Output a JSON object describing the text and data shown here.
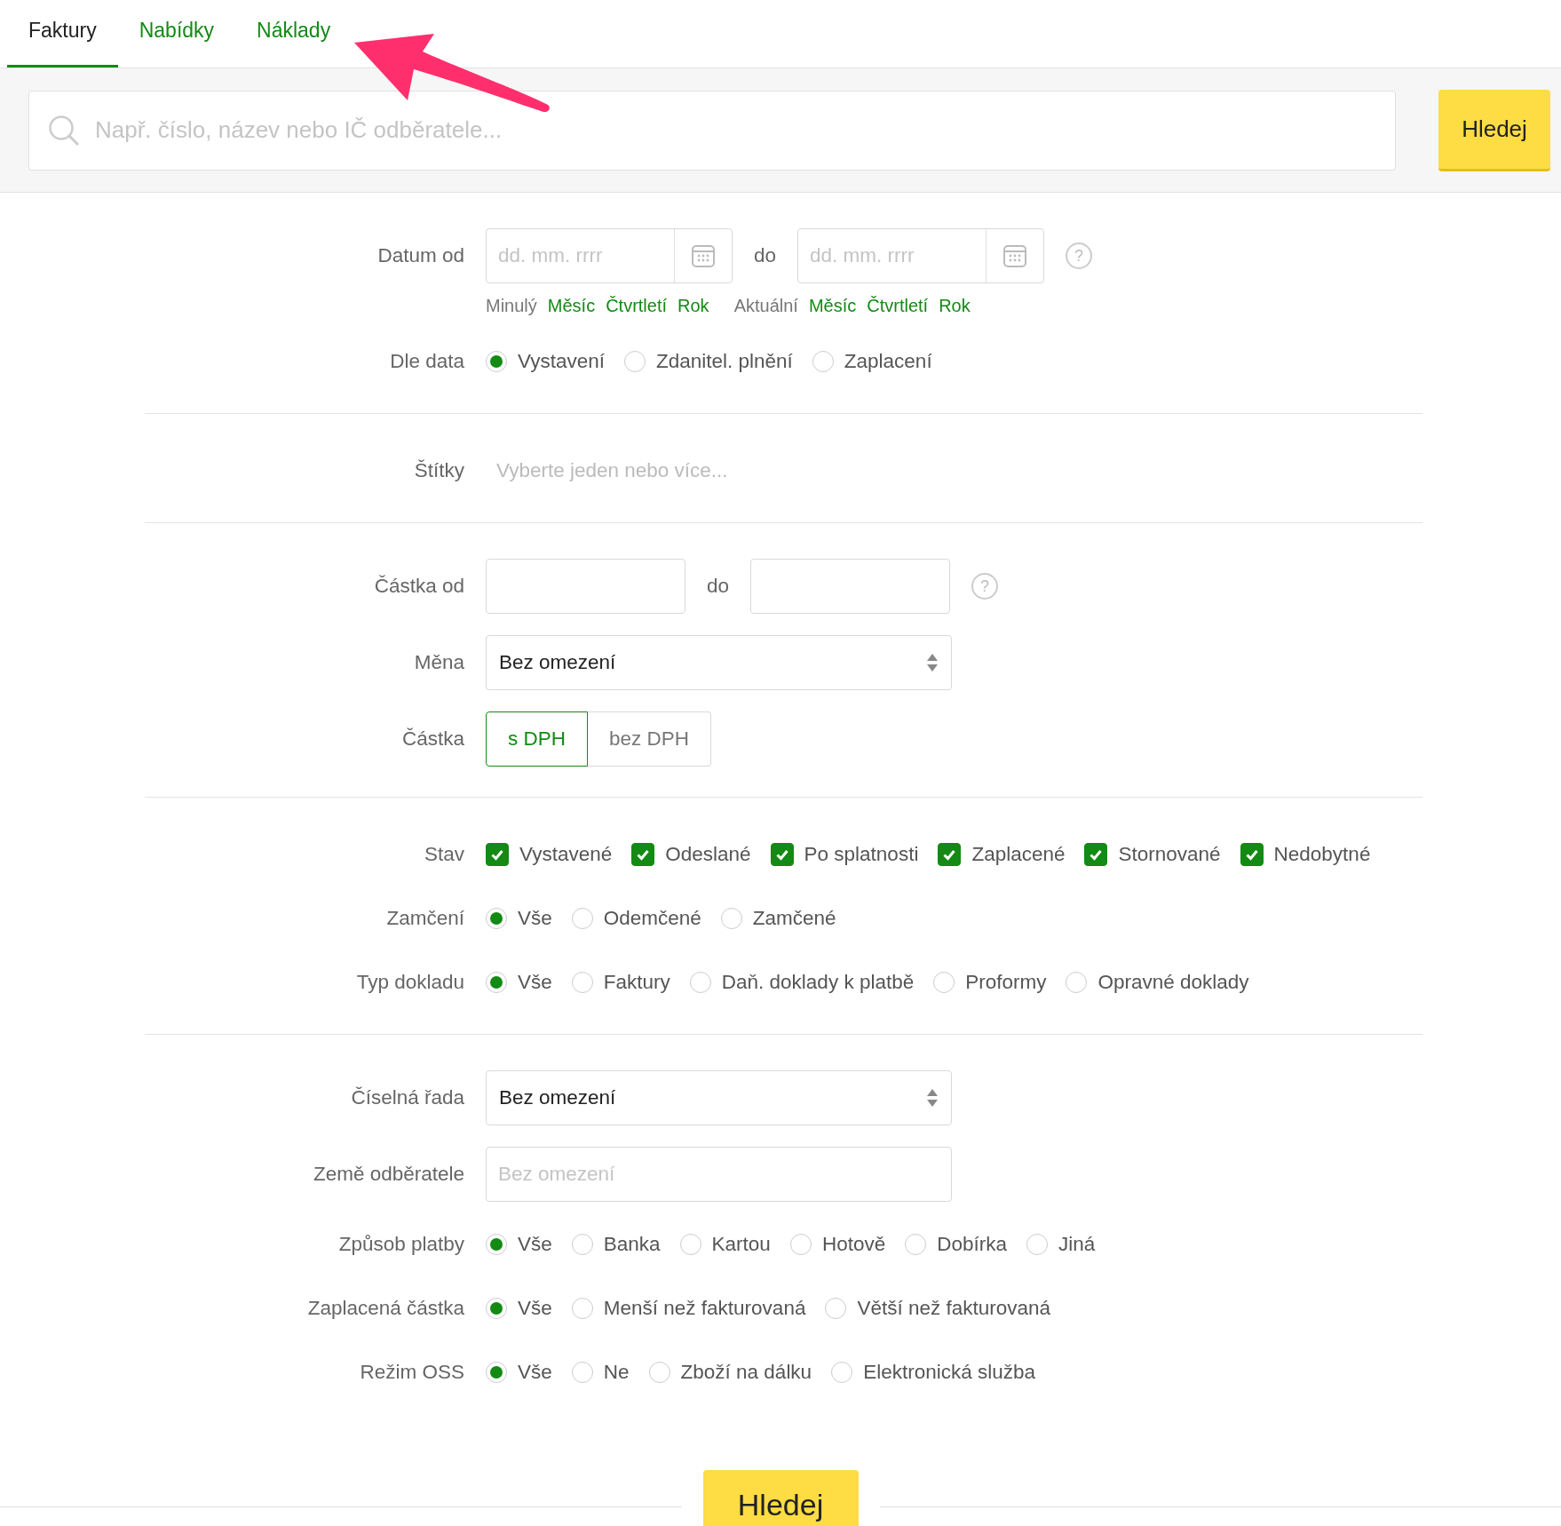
{
  "tabs": [
    {
      "label": "Faktury",
      "selected": true
    },
    {
      "label": "Nabídky",
      "selected": false
    },
    {
      "label": "Náklady",
      "selected": false
    }
  ],
  "search": {
    "placeholder": "Např. číslo, název nebo IČ odběratele...",
    "button": "Hledej"
  },
  "sections": [
    {
      "rows": [
        {
          "kind": "date",
          "label": "Datum od",
          "from_placeholder": "dd. mm. rrrr",
          "to_label": "do",
          "to_placeholder": "dd. mm. rrrr",
          "help": "?",
          "presets": [
            {
              "label": "Minulý",
              "links": [
                "Měsíc",
                "Čtvrtletí",
                "Rok"
              ]
            },
            {
              "label": "Aktuální",
              "links": [
                "Měsíc",
                "Čtvrtletí",
                "Rok"
              ]
            }
          ]
        },
        {
          "kind": "radio",
          "label": "Dle data",
          "options": [
            {
              "label": "Vystavení",
              "selected": true
            },
            {
              "label": "Zdanitel. plnění",
              "selected": false
            },
            {
              "label": "Zaplacení",
              "selected": false
            }
          ]
        }
      ]
    },
    {
      "rows": [
        {
          "kind": "tags",
          "label": "Štítky",
          "placeholder": "Vyberte jeden nebo více..."
        }
      ]
    },
    {
      "rows": [
        {
          "kind": "range",
          "label": "Částka od",
          "to_label": "do",
          "help": "?"
        },
        {
          "kind": "select",
          "label": "Měna",
          "value": "Bez omezení"
        },
        {
          "kind": "toggle",
          "label": "Částka",
          "options": [
            {
              "label": "s DPH",
              "selected": true
            },
            {
              "label": "bez DPH",
              "selected": false
            }
          ]
        }
      ]
    },
    {
      "rows": [
        {
          "kind": "checks",
          "label": "Stav",
          "options": [
            {
              "label": "Vystavené",
              "checked": true
            },
            {
              "label": "Odeslané",
              "checked": true
            },
            {
              "label": "Po splatnosti",
              "checked": true
            },
            {
              "label": "Zaplacené",
              "checked": true
            },
            {
              "label": "Stornované",
              "checked": true
            },
            {
              "label": "Nedobytné",
              "checked": true
            }
          ]
        },
        {
          "kind": "radio",
          "label": "Zamčení",
          "options": [
            {
              "label": "Vše",
              "selected": true
            },
            {
              "label": "Odemčené",
              "selected": false
            },
            {
              "label": "Zamčené",
              "selected": false
            }
          ]
        },
        {
          "kind": "radio",
          "label": "Typ dokladu",
          "options": [
            {
              "label": "Vše",
              "selected": true
            },
            {
              "label": "Faktury",
              "selected": false
            },
            {
              "label": "Daň. doklady k platbě",
              "selected": false
            },
            {
              "label": "Proformy",
              "selected": false
            },
            {
              "label": "Opravné doklady",
              "selected": false
            }
          ]
        }
      ]
    },
    {
      "rows": [
        {
          "kind": "select",
          "label": "Číselná řada",
          "value": "Bez omezení"
        },
        {
          "kind": "input",
          "label": "Země odběratele",
          "placeholder": "Bez omezení"
        },
        {
          "kind": "radio",
          "label": "Způsob platby",
          "options": [
            {
              "label": "Vše",
              "selected": true
            },
            {
              "label": "Banka",
              "selected": false
            },
            {
              "label": "Kartou",
              "selected": false
            },
            {
              "label": "Hotově",
              "selected": false
            },
            {
              "label": "Dobírka",
              "selected": false
            },
            {
              "label": "Jiná",
              "selected": false
            }
          ]
        },
        {
          "kind": "radio",
          "label": "Zaplacená částka",
          "options": [
            {
              "label": "Vše",
              "selected": true
            },
            {
              "label": "Menší než fakturovaná",
              "selected": false
            },
            {
              "label": "Větší než fakturovaná",
              "selected": false
            }
          ]
        },
        {
          "kind": "radio",
          "label": "Režim OSS",
          "options": [
            {
              "label": "Vše",
              "selected": true
            },
            {
              "label": "Ne",
              "selected": false
            },
            {
              "label": "Zboží na dálku",
              "selected": false
            },
            {
              "label": "Elektronická služba",
              "selected": false
            }
          ]
        }
      ]
    }
  ],
  "footer": {
    "button": "Hledej"
  }
}
